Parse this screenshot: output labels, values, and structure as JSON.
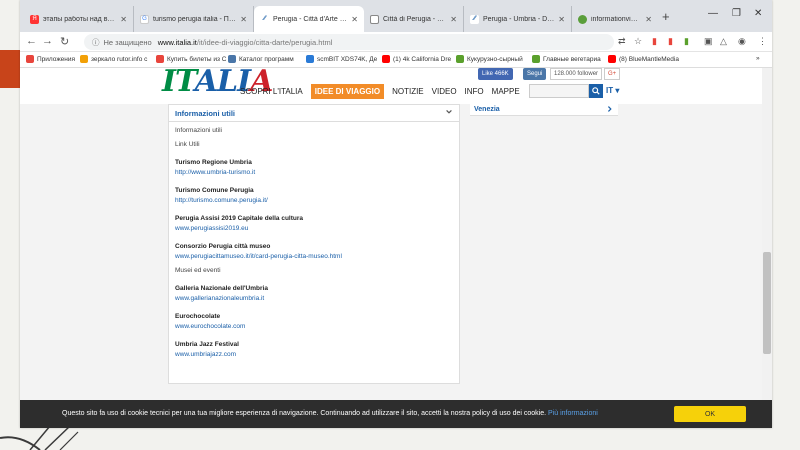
{
  "browser": {
    "tabs": [
      {
        "label": "этапы работы над веб кейс",
        "icon": "yandex-icon",
        "color": "#ff3333"
      },
      {
        "label": "turismo perugia italia - Пои",
        "icon": "google-icon",
        "color": "#4285f4"
      },
      {
        "label": "Perugia - Città d'Arte - Idee",
        "icon": "italia-icon",
        "color": "#1a5fa8"
      },
      {
        "label": "Città di Perugia - Turismo",
        "icon": "page-icon",
        "color": "#888888"
      },
      {
        "label": "Perugia - Umbria - Discove",
        "icon": "italia-icon",
        "color": "#1a5fa8"
      },
      {
        "label": "informationvine.it",
        "icon": "globe-icon",
        "color": "#5a9e3a"
      }
    ],
    "new_tab": "+",
    "window_controls": {
      "minimize": "—",
      "maximize": "❐",
      "close": "✕"
    },
    "address": {
      "insecure_label": "Не защищено",
      "domain": "www.italia.it",
      "path": "/it/idee-di-viaggio/citta-darte/perugia.html"
    },
    "bookmarks": [
      {
        "label": "Приложения",
        "color": "#e8453c"
      },
      {
        "label": "зеркало rutor.info c",
        "color": "#f2a007"
      },
      {
        "label": "Купить билеты из С",
        "color": "#e8453c"
      },
      {
        "label": "Каталог программ",
        "color": "#4a76a8"
      },
      {
        "label": "scmBIT XDS74K, Де",
        "color": "#2a7ad6"
      },
      {
        "label": "(1) 4k California Dre",
        "color": "#ff0000"
      },
      {
        "label": "Кукурузно-сырный",
        "color": "#5aa02c"
      },
      {
        "label": "Главные вегетариа",
        "color": "#5aa02c"
      },
      {
        "label": "(8) BlueMantleMedia",
        "color": "#ff0000"
      }
    ],
    "bookmarks_more": "»"
  },
  "site": {
    "logo": {
      "p1": "IT",
      "p2": "ALI",
      "p3": "A"
    },
    "nav": [
      "SCOPRI L'ITALIA",
      "IDEE DI VIAGGIO",
      "NOTIZIE",
      "VIDEO",
      "INFO",
      "MAPPE"
    ],
    "social": {
      "fb": "Like 466K",
      "vk": "Segui",
      "count": "128.000 follower",
      "gplus": "G+"
    },
    "lang": "IT"
  },
  "accordion": {
    "title": "Informazioni utili",
    "items": [
      {
        "type": "plain",
        "text": "Informazioni utili"
      },
      {
        "type": "plain",
        "text": "Link Utili"
      },
      {
        "type": "title",
        "text": "Turismo Regione Umbria"
      },
      {
        "type": "link",
        "text": "http://www.umbria-turismo.it"
      },
      {
        "type": "title",
        "text": "Turismo Comune Perugia"
      },
      {
        "type": "link",
        "text": "http://turismo.comune.perugia.it/"
      },
      {
        "type": "title",
        "text": "Perugia Assisi 2019 Capitale della cultura"
      },
      {
        "type": "link",
        "text": "www.perugiassisi2019.eu"
      },
      {
        "type": "title",
        "text": "Consorzio Perugia città museo"
      },
      {
        "type": "link",
        "text": "www.perugiacittamuseo.it/it/card-perugia-citta-museo.html"
      },
      {
        "type": "plain",
        "text": "Musei ed eventi"
      },
      {
        "type": "title",
        "text": "Galleria Nazionale dell'Umbria"
      },
      {
        "type": "link",
        "text": "www.gallerianazionaleumbria.it"
      },
      {
        "type": "title",
        "text": "Eurochocolate"
      },
      {
        "type": "link",
        "text": "www.eurochocolate.com"
      },
      {
        "type": "title",
        "text": "Umbria Jazz Festival"
      },
      {
        "type": "link",
        "text": "www.umbriajazz.com"
      }
    ]
  },
  "side": {
    "item": "Venezia"
  },
  "cookie": {
    "text": "Questo sito fa uso di cookie tecnici per una tua migliore esperienza di navigazione. Continuando ad utilizzare il sito, accetti la nostra policy di uso dei cookie.",
    "more": "Più informazioni",
    "ok": "OK"
  }
}
